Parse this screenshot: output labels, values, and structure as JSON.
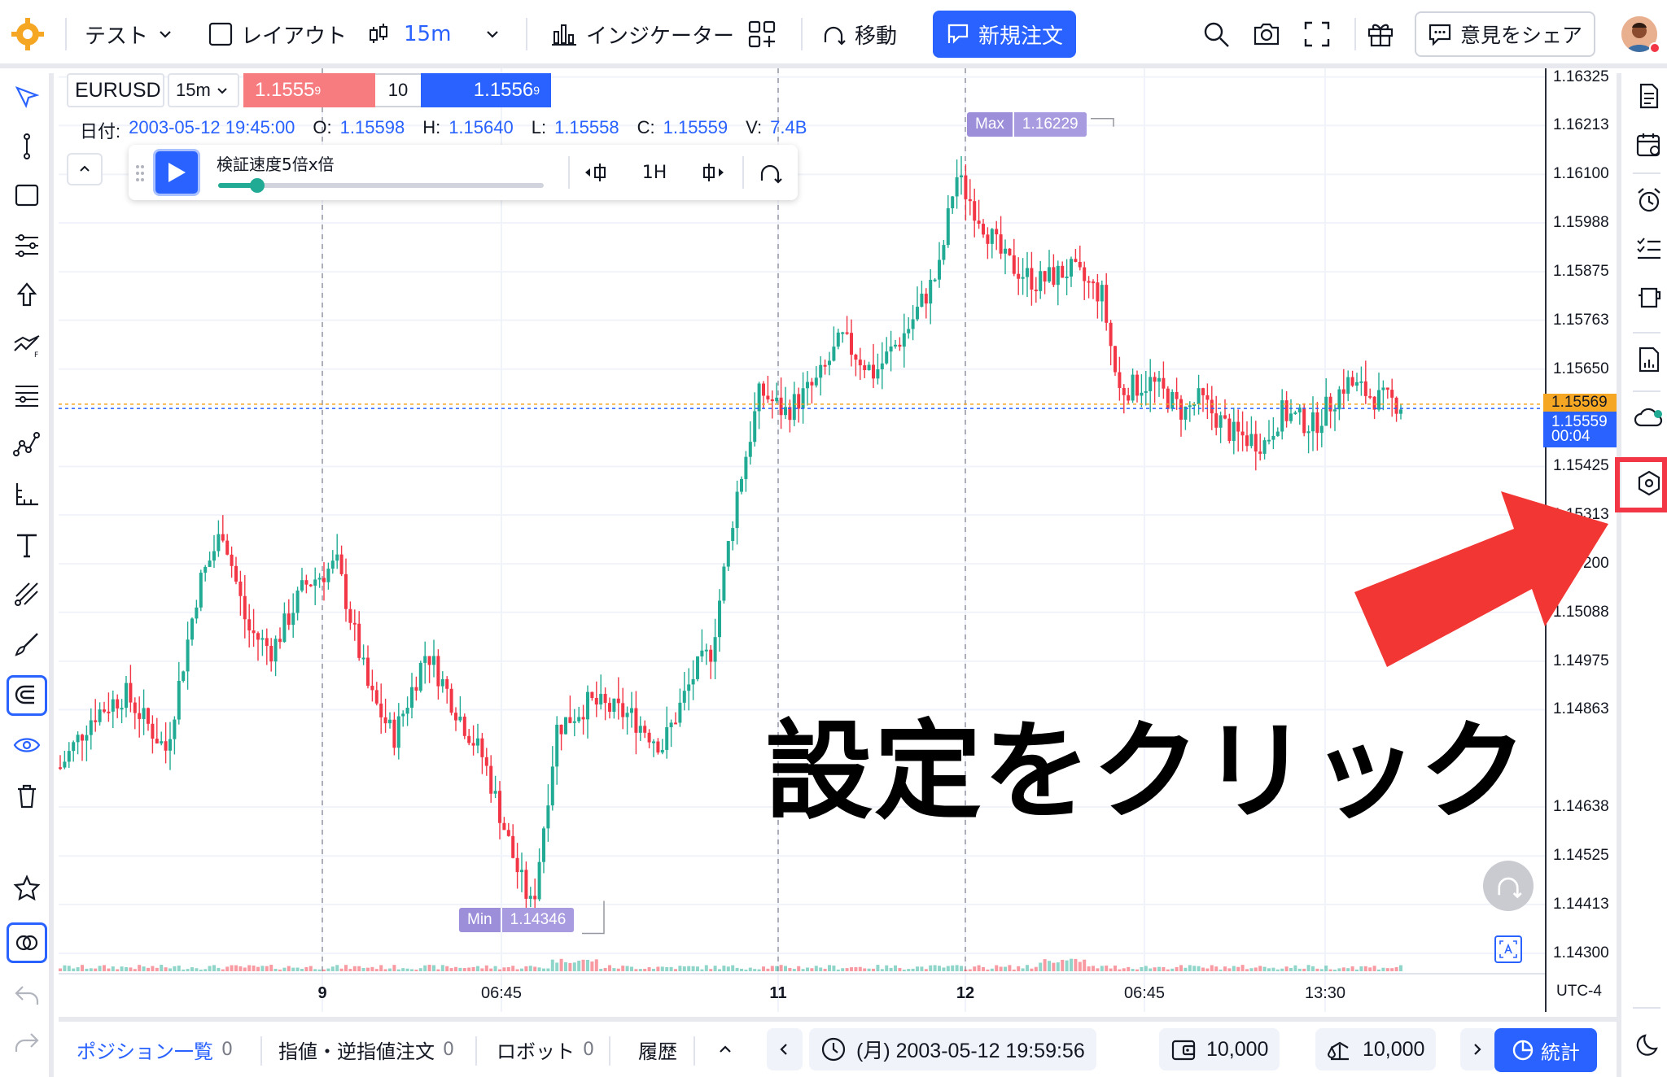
{
  "topbar": {
    "account": "テスト",
    "layout": "レイアウト",
    "interval": "15m",
    "indicators": "インジケーター",
    "move": "移動",
    "new_order": "新規注文",
    "feedback": "意見をシェア"
  },
  "symbol": {
    "name": "EURUSD",
    "interval": "15m",
    "bid": "1.1555",
    "bid_sup": "9",
    "qty": "10",
    "ask": "1.1556",
    "ask_sup": "9"
  },
  "ohlc": {
    "date_label": "日付:",
    "date": "2003-05-12 19:45:00",
    "o_label": "O:",
    "o": "1.15598",
    "h_label": "H:",
    "h": "1.15640",
    "l_label": "L:",
    "l": "1.15558",
    "c_label": "C:",
    "c": "1.15559",
    "v_label": "V:",
    "v": "7.4B"
  },
  "replay": {
    "speed_label": "検証速度5倍x倍",
    "speed_fraction": 0.12,
    "interval": "1H"
  },
  "chart_data": {
    "type": "candlestick",
    "price_ticks": [
      "1.16325",
      "1.16213",
      "1.16100",
      "1.15988",
      "1.15875",
      "1.15763",
      "1.15650",
      "1.15425",
      "1.15313",
      "1.15200",
      "1.15088",
      "1.14975",
      "1.14863",
      "1.14638",
      "1.14525",
      "1.14413",
      "1.14300"
    ],
    "time_ticks": [
      {
        "label": "9",
        "bold": true
      },
      {
        "label": "06:45",
        "bold": false
      },
      {
        "label": "11",
        "bold": true
      },
      {
        "label": "12",
        "bold": true
      },
      {
        "label": "06:45",
        "bold": false
      },
      {
        "label": "13:30",
        "bold": false
      }
    ],
    "max_label": "Max",
    "max_value": "1.16229",
    "min_label": "Min",
    "min_value": "1.14346",
    "last_price_tag": "1.15569",
    "current_price_tag": "1.15559",
    "countdown": "00:04",
    "timezone": "UTC-4",
    "ylim": [
      1.143,
      1.1633
    ],
    "up_color": "#22ab94",
    "down_color": "#f23645"
  },
  "bottombar": {
    "positions_label": "ポジション一覧",
    "positions_count": "0",
    "orders_label": "指値・逆指値注文",
    "orders_count": "0",
    "robot_label": "ロボット",
    "robot_count": "0",
    "history_label": "履歴",
    "datetime": "(月) 2003-05-12 19:59:56",
    "balance": "10,000",
    "equity": "10,000",
    "stats": "統計"
  },
  "annotation": {
    "text": "設定をクリック"
  }
}
